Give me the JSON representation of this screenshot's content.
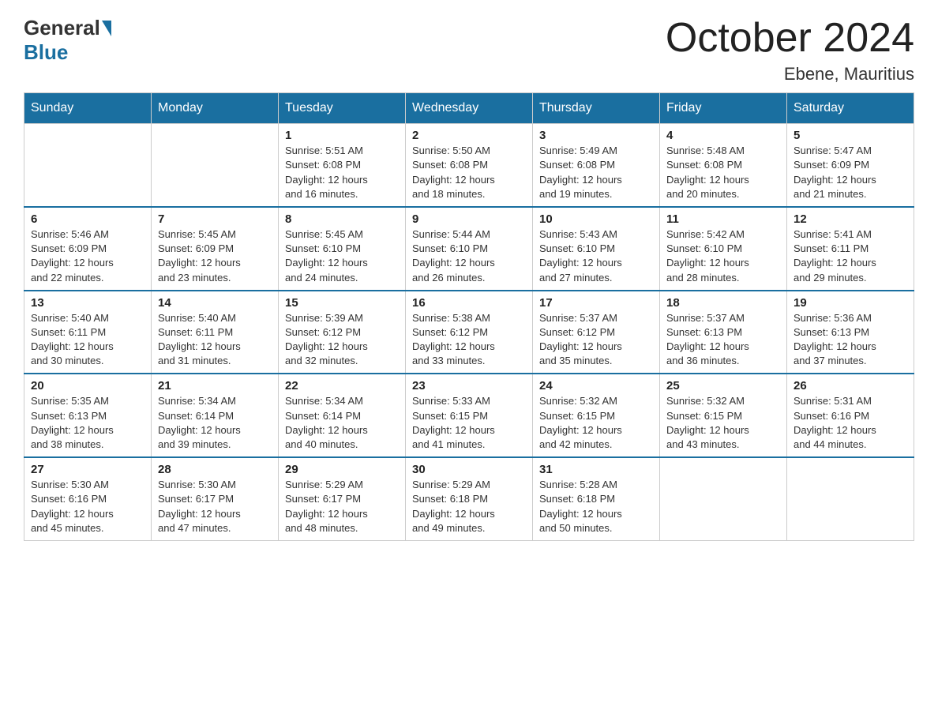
{
  "header": {
    "logo_general": "General",
    "logo_blue": "Blue",
    "month_title": "October 2024",
    "subtitle": "Ebene, Mauritius"
  },
  "days_of_week": [
    "Sunday",
    "Monday",
    "Tuesday",
    "Wednesday",
    "Thursday",
    "Friday",
    "Saturday"
  ],
  "weeks": [
    [
      {
        "day": "",
        "info": ""
      },
      {
        "day": "",
        "info": ""
      },
      {
        "day": "1",
        "info": "Sunrise: 5:51 AM\nSunset: 6:08 PM\nDaylight: 12 hours\nand 16 minutes."
      },
      {
        "day": "2",
        "info": "Sunrise: 5:50 AM\nSunset: 6:08 PM\nDaylight: 12 hours\nand 18 minutes."
      },
      {
        "day": "3",
        "info": "Sunrise: 5:49 AM\nSunset: 6:08 PM\nDaylight: 12 hours\nand 19 minutes."
      },
      {
        "day": "4",
        "info": "Sunrise: 5:48 AM\nSunset: 6:08 PM\nDaylight: 12 hours\nand 20 minutes."
      },
      {
        "day": "5",
        "info": "Sunrise: 5:47 AM\nSunset: 6:09 PM\nDaylight: 12 hours\nand 21 minutes."
      }
    ],
    [
      {
        "day": "6",
        "info": "Sunrise: 5:46 AM\nSunset: 6:09 PM\nDaylight: 12 hours\nand 22 minutes."
      },
      {
        "day": "7",
        "info": "Sunrise: 5:45 AM\nSunset: 6:09 PM\nDaylight: 12 hours\nand 23 minutes."
      },
      {
        "day": "8",
        "info": "Sunrise: 5:45 AM\nSunset: 6:10 PM\nDaylight: 12 hours\nand 24 minutes."
      },
      {
        "day": "9",
        "info": "Sunrise: 5:44 AM\nSunset: 6:10 PM\nDaylight: 12 hours\nand 26 minutes."
      },
      {
        "day": "10",
        "info": "Sunrise: 5:43 AM\nSunset: 6:10 PM\nDaylight: 12 hours\nand 27 minutes."
      },
      {
        "day": "11",
        "info": "Sunrise: 5:42 AM\nSunset: 6:10 PM\nDaylight: 12 hours\nand 28 minutes."
      },
      {
        "day": "12",
        "info": "Sunrise: 5:41 AM\nSunset: 6:11 PM\nDaylight: 12 hours\nand 29 minutes."
      }
    ],
    [
      {
        "day": "13",
        "info": "Sunrise: 5:40 AM\nSunset: 6:11 PM\nDaylight: 12 hours\nand 30 minutes."
      },
      {
        "day": "14",
        "info": "Sunrise: 5:40 AM\nSunset: 6:11 PM\nDaylight: 12 hours\nand 31 minutes."
      },
      {
        "day": "15",
        "info": "Sunrise: 5:39 AM\nSunset: 6:12 PM\nDaylight: 12 hours\nand 32 minutes."
      },
      {
        "day": "16",
        "info": "Sunrise: 5:38 AM\nSunset: 6:12 PM\nDaylight: 12 hours\nand 33 minutes."
      },
      {
        "day": "17",
        "info": "Sunrise: 5:37 AM\nSunset: 6:12 PM\nDaylight: 12 hours\nand 35 minutes."
      },
      {
        "day": "18",
        "info": "Sunrise: 5:37 AM\nSunset: 6:13 PM\nDaylight: 12 hours\nand 36 minutes."
      },
      {
        "day": "19",
        "info": "Sunrise: 5:36 AM\nSunset: 6:13 PM\nDaylight: 12 hours\nand 37 minutes."
      }
    ],
    [
      {
        "day": "20",
        "info": "Sunrise: 5:35 AM\nSunset: 6:13 PM\nDaylight: 12 hours\nand 38 minutes."
      },
      {
        "day": "21",
        "info": "Sunrise: 5:34 AM\nSunset: 6:14 PM\nDaylight: 12 hours\nand 39 minutes."
      },
      {
        "day": "22",
        "info": "Sunrise: 5:34 AM\nSunset: 6:14 PM\nDaylight: 12 hours\nand 40 minutes."
      },
      {
        "day": "23",
        "info": "Sunrise: 5:33 AM\nSunset: 6:15 PM\nDaylight: 12 hours\nand 41 minutes."
      },
      {
        "day": "24",
        "info": "Sunrise: 5:32 AM\nSunset: 6:15 PM\nDaylight: 12 hours\nand 42 minutes."
      },
      {
        "day": "25",
        "info": "Sunrise: 5:32 AM\nSunset: 6:15 PM\nDaylight: 12 hours\nand 43 minutes."
      },
      {
        "day": "26",
        "info": "Sunrise: 5:31 AM\nSunset: 6:16 PM\nDaylight: 12 hours\nand 44 minutes."
      }
    ],
    [
      {
        "day": "27",
        "info": "Sunrise: 5:30 AM\nSunset: 6:16 PM\nDaylight: 12 hours\nand 45 minutes."
      },
      {
        "day": "28",
        "info": "Sunrise: 5:30 AM\nSunset: 6:17 PM\nDaylight: 12 hours\nand 47 minutes."
      },
      {
        "day": "29",
        "info": "Sunrise: 5:29 AM\nSunset: 6:17 PM\nDaylight: 12 hours\nand 48 minutes."
      },
      {
        "day": "30",
        "info": "Sunrise: 5:29 AM\nSunset: 6:18 PM\nDaylight: 12 hours\nand 49 minutes."
      },
      {
        "day": "31",
        "info": "Sunrise: 5:28 AM\nSunset: 6:18 PM\nDaylight: 12 hours\nand 50 minutes."
      },
      {
        "day": "",
        "info": ""
      },
      {
        "day": "",
        "info": ""
      }
    ]
  ]
}
